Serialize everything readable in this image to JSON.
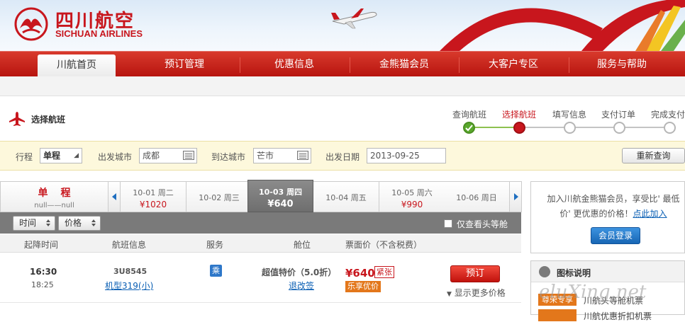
{
  "brand": {
    "name_cn": "四川航空",
    "name_en": "SICHUAN AIRLINES",
    "color": "#c8161d"
  },
  "nav": {
    "items": [
      {
        "label": "川航首页",
        "active": true
      },
      {
        "label": "预订管理"
      },
      {
        "label": "优惠信息"
      },
      {
        "label": "金熊猫会员"
      },
      {
        "label": "大客户专区"
      },
      {
        "label": "服务与帮助"
      }
    ]
  },
  "steps": {
    "title": "选择航班",
    "items": [
      {
        "label": "查询航班",
        "state": "done"
      },
      {
        "label": "选择航班",
        "state": "current"
      },
      {
        "label": "填写信息",
        "state": "todo"
      },
      {
        "label": "支付订单",
        "state": "todo"
      },
      {
        "label": "完成支付",
        "state": "todo"
      }
    ]
  },
  "search": {
    "trip_label": "行程",
    "trip_value": "单程",
    "from_label": "出发城市",
    "from_value": "成都",
    "to_label": "到达城市",
    "to_value": "芒市",
    "date_label": "出发日期",
    "date_value": "2013-09-25",
    "requery_label": "重新查询"
  },
  "trip_summary": {
    "type": "单程",
    "route": "null——null"
  },
  "dates": [
    {
      "date": "10-01",
      "weekday": "周二",
      "price": "¥1020"
    },
    {
      "date": "10-02",
      "weekday": "周三",
      "price": ""
    },
    {
      "date": "10-03",
      "weekday": "周四",
      "price": "¥640",
      "selected": true
    },
    {
      "date": "10-04",
      "weekday": "周五",
      "price": ""
    },
    {
      "date": "10-05",
      "weekday": "周六",
      "price": "¥990"
    },
    {
      "date": "10-06",
      "weekday": "周日",
      "price": ""
    }
  ],
  "sort": {
    "time_label": "时间",
    "price_label": "价格",
    "first_class_only_label": "仅查看头等舱"
  },
  "table": {
    "headers": {
      "time": "起降时间",
      "flight": "航班信息",
      "service": "服务",
      "cabin": "舱位",
      "price": "票面价（不含税费）"
    }
  },
  "flight": {
    "depart": "16:30",
    "arrive": "18:25",
    "number": "3U8545",
    "aircraft": "机型319(小)",
    "service_badge": "乘",
    "fare_name": "超值特价（5.0折）",
    "refund_link": "退改签",
    "price": "¥640",
    "tight_badge": "紧张",
    "promo_badge": "乐享优价",
    "book_label": "预订",
    "more_prices": "显示更多价格"
  },
  "member": {
    "text": "加入川航金熊猫会员，享受比' 最低价' 更优惠的价格！",
    "link": "点此加入",
    "login": "会员登录"
  },
  "legend": {
    "title": "图标说明",
    "items": [
      {
        "tag": "尊荣专享",
        "text": "川航头等舱机票",
        "color": "#e3771b"
      },
      {
        "tag": "",
        "text": "川航优惠折扣机票",
        "color": "#e3771b"
      }
    ]
  },
  "watermark": "eluXing.net"
}
